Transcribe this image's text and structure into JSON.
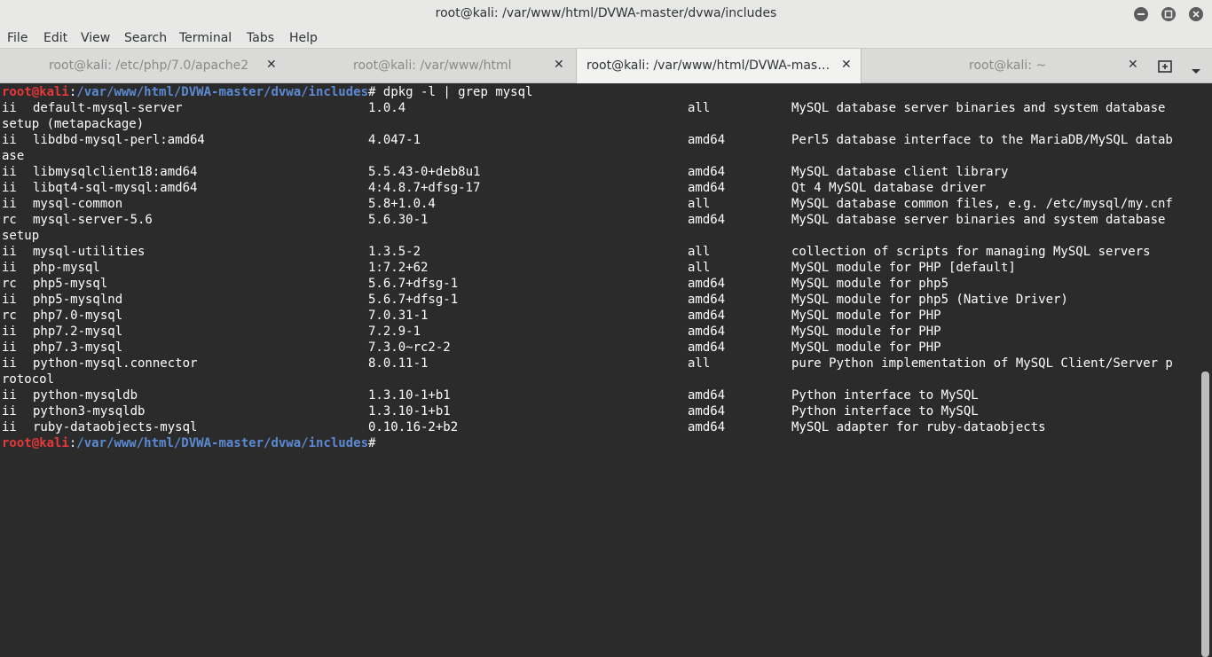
{
  "window": {
    "title": "root@kali: /var/www/html/DVWA-master/dvwa/includes"
  },
  "menu": [
    "File",
    "Edit",
    "View",
    "Search",
    "Terminal",
    "Tabs",
    "Help"
  ],
  "tabs": [
    {
      "label": "root@kali: /etc/php/7.0/apache2",
      "active": false
    },
    {
      "label": "root@kali: /var/www/html",
      "active": false
    },
    {
      "label": "root@kali: /var/www/html/DVWA-mas…",
      "active": true
    },
    {
      "label": "root@kali: ~",
      "active": false
    }
  ],
  "tab_close_glyph": "✕",
  "prompt": {
    "user": "root@kali",
    "sep": ":",
    "path": "/var/www/html/DVWA-master/dvwa/includes",
    "symbol": "#"
  },
  "command": " dpkg -l | grep mysql",
  "rows": [
    {
      "status": "ii",
      "name": "default-mysql-server",
      "version": "1.0.4",
      "arch": "all",
      "desc": "MySQL database server binaries and system database",
      "wrap": "setup (metapackage)"
    },
    {
      "status": "ii",
      "name": "libdbd-mysql-perl:amd64",
      "version": "4.047-1",
      "arch": "amd64",
      "desc": "Perl5 database interface to the MariaDB/MySQL datab",
      "wrap": "ase"
    },
    {
      "status": "ii",
      "name": "libmysqlclient18:amd64",
      "version": "5.5.43-0+deb8u1",
      "arch": "amd64",
      "desc": "MySQL database client library",
      "wrap": ""
    },
    {
      "status": "ii",
      "name": "libqt4-sql-mysql:amd64",
      "version": "4:4.8.7+dfsg-17",
      "arch": "amd64",
      "desc": "Qt 4 MySQL database driver",
      "wrap": ""
    },
    {
      "status": "ii",
      "name": "mysql-common",
      "version": "5.8+1.0.4",
      "arch": "all",
      "desc": "MySQL database common files, e.g. /etc/mysql/my.cnf",
      "wrap": ""
    },
    {
      "status": "rc",
      "name": "mysql-server-5.6",
      "version": "5.6.30-1",
      "arch": "amd64",
      "desc": "MySQL database server binaries and system database",
      "wrap": "setup"
    },
    {
      "status": "ii",
      "name": "mysql-utilities",
      "version": "1.3.5-2",
      "arch": "all",
      "desc": "collection of scripts for managing MySQL servers",
      "wrap": ""
    },
    {
      "status": "ii",
      "name": "php-mysql",
      "version": "1:7.2+62",
      "arch": "all",
      "desc": "MySQL module for PHP [default]",
      "wrap": ""
    },
    {
      "status": "rc",
      "name": "php5-mysql",
      "version": "5.6.7+dfsg-1",
      "arch": "amd64",
      "desc": "MySQL module for php5",
      "wrap": ""
    },
    {
      "status": "ii",
      "name": "php5-mysqlnd",
      "version": "5.6.7+dfsg-1",
      "arch": "amd64",
      "desc": "MySQL module for php5 (Native Driver)",
      "wrap": ""
    },
    {
      "status": "rc",
      "name": "php7.0-mysql",
      "version": "7.0.31-1",
      "arch": "amd64",
      "desc": "MySQL module for PHP",
      "wrap": ""
    },
    {
      "status": "ii",
      "name": "php7.2-mysql",
      "version": "7.2.9-1",
      "arch": "amd64",
      "desc": "MySQL module for PHP",
      "wrap": ""
    },
    {
      "status": "ii",
      "name": "php7.3-mysql",
      "version": "7.3.0~rc2-2",
      "arch": "amd64",
      "desc": "MySQL module for PHP",
      "wrap": ""
    },
    {
      "status": "ii",
      "name": "python-mysql.connector",
      "version": "8.0.11-1",
      "arch": "all",
      "desc": "pure Python implementation of MySQL Client/Server p",
      "wrap": "rotocol"
    },
    {
      "status": "ii",
      "name": "python-mysqldb",
      "version": "1.3.10-1+b1",
      "arch": "amd64",
      "desc": "Python interface to MySQL",
      "wrap": ""
    },
    {
      "status": "ii",
      "name": "python3-mysqldb",
      "version": "1.3.10-1+b1",
      "arch": "amd64",
      "desc": "Python interface to MySQL",
      "wrap": ""
    },
    {
      "status": "ii",
      "name": "ruby-dataobjects-mysql",
      "version": "0.10.16-2+b2",
      "arch": "amd64",
      "desc": "MySQL adapter for ruby-dataobjects",
      "wrap": ""
    }
  ],
  "colors": {
    "prompt_user": "#e5383b",
    "prompt_path": "#5c8ad2",
    "terminal_bg": "#2b2b2b",
    "terminal_fg": "#ffffff"
  }
}
